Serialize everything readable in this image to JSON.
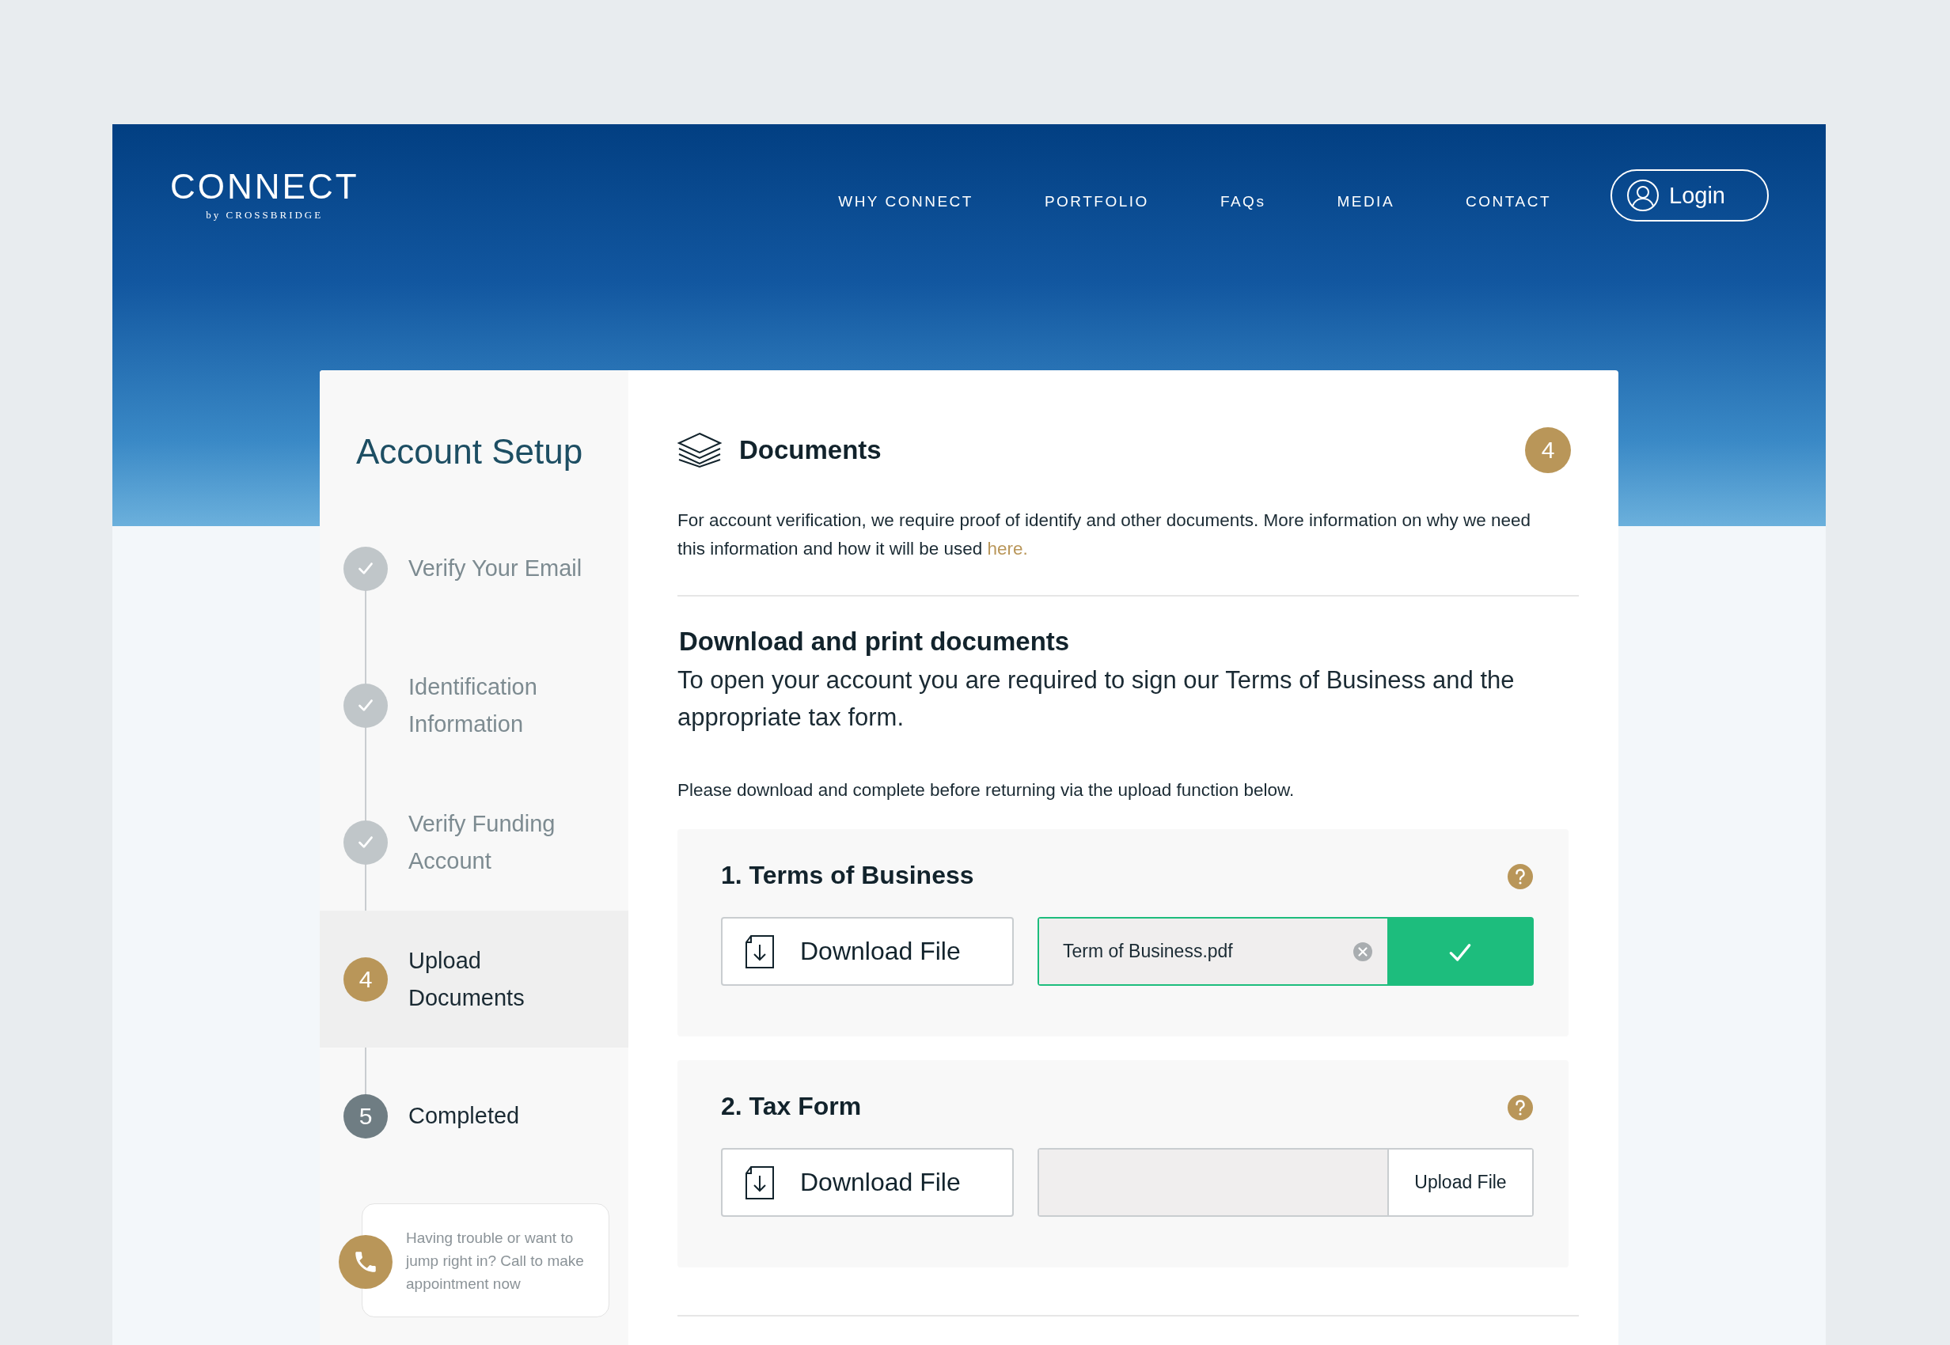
{
  "brand": {
    "name": "CONNECT",
    "tagline": "by CROSSBRIDGE"
  },
  "nav": [
    {
      "label": "WHY CONNECT"
    },
    {
      "label": "PORTFOLIO"
    },
    {
      "label": "FAQs"
    },
    {
      "label": "MEDIA"
    },
    {
      "label": "CONTACT"
    }
  ],
  "login": {
    "label": "Login"
  },
  "sidebar": {
    "title": "Account Setup",
    "steps": [
      {
        "label": "Verify Your Email",
        "kind": "done"
      },
      {
        "label": "Identification Information",
        "kind": "done"
      },
      {
        "label": "Verify Funding Account",
        "kind": "done"
      },
      {
        "label": "Upload Documents",
        "kind": "current",
        "number": "4"
      },
      {
        "label": "Completed",
        "kind": "upcoming",
        "number": "5"
      }
    ],
    "help": {
      "text": "Having trouble or want to jump right in? Call to make appointment now"
    }
  },
  "section": {
    "title": "Documents",
    "step_badge": "4",
    "intro": "For account verification, we require proof of identify and other documents. More information on why we need this information and how it will be used",
    "intro_link": "here.",
    "heading": "Download and print documents",
    "lead": "To open your account you are required to sign our Terms of Business and the appropriate tax form.",
    "instruction": "Please download and complete before returning via the upload function below.",
    "documents": [
      {
        "title": "1. Terms of Business",
        "download_label": "Download File",
        "kind": "uploaded",
        "file_name": "Term of Business.pdf"
      },
      {
        "title": "2. Tax Form",
        "download_label": "Download File",
        "kind": "empty",
        "upload_label": "Upload File"
      }
    ]
  }
}
